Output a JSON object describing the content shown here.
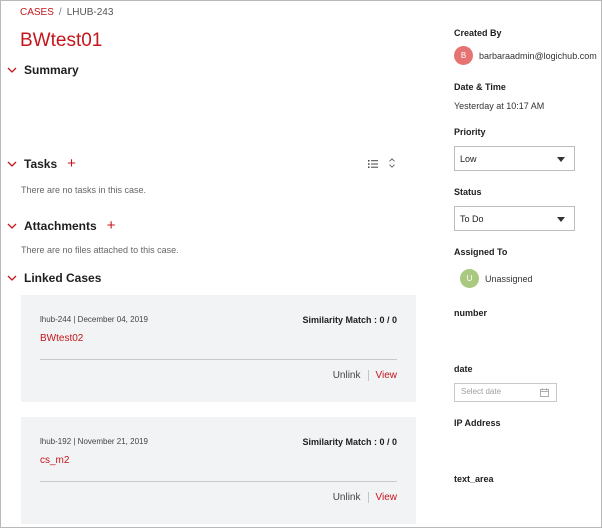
{
  "breadcrumb": {
    "root": "CASES",
    "separator": "/",
    "current": "LHUB-243"
  },
  "case": {
    "title": "BWtest01"
  },
  "sections": {
    "summary": {
      "title": "Summary"
    },
    "tasks": {
      "title": "Tasks",
      "empty": "There are no tasks in this case.",
      "add_glyph": "+"
    },
    "attachments": {
      "title": "Attachments",
      "empty": "There are no files attached to this case.",
      "add_glyph": "+"
    },
    "linked": {
      "title": "Linked Cases",
      "items": [
        {
          "meta": "lhub-244 | December 04, 2019",
          "similarity": "Similarity Match : 0 / 0",
          "name": "BWtest02",
          "unlink": "Unlink",
          "view": "View"
        },
        {
          "meta": "lhub-192 | November 21, 2019",
          "similarity": "Similarity Match : 0 / 0",
          "name": "cs_m2",
          "unlink": "Unlink",
          "view": "View"
        }
      ]
    }
  },
  "sidebar": {
    "created_by": {
      "label": "Created By",
      "avatar": "B",
      "avatar_color": "#e57373",
      "value": "barbaraadmin@logichub.com"
    },
    "date_time": {
      "label": "Date & Time",
      "value": "Yesterday at 10:17 AM"
    },
    "priority": {
      "label": "Priority",
      "value": "Low"
    },
    "status": {
      "label": "Status",
      "value": "To Do"
    },
    "assigned_to": {
      "label": "Assigned To",
      "avatar": "U",
      "avatar_color": "#a8c97f",
      "value": "Unassigned"
    },
    "number": {
      "label": "number"
    },
    "date": {
      "label": "date",
      "placeholder": "Select date"
    },
    "ip_address": {
      "label": "IP Address"
    },
    "text_area": {
      "label": "text_area"
    }
  },
  "colors": {
    "accent": "#c4161c",
    "card_bg": "#f2f3f4"
  },
  "icons": [
    "chevron-down-icon",
    "plus-icon",
    "list-sort-icon",
    "expand-collapse-icon",
    "caret-down-icon",
    "calendar-icon"
  ]
}
